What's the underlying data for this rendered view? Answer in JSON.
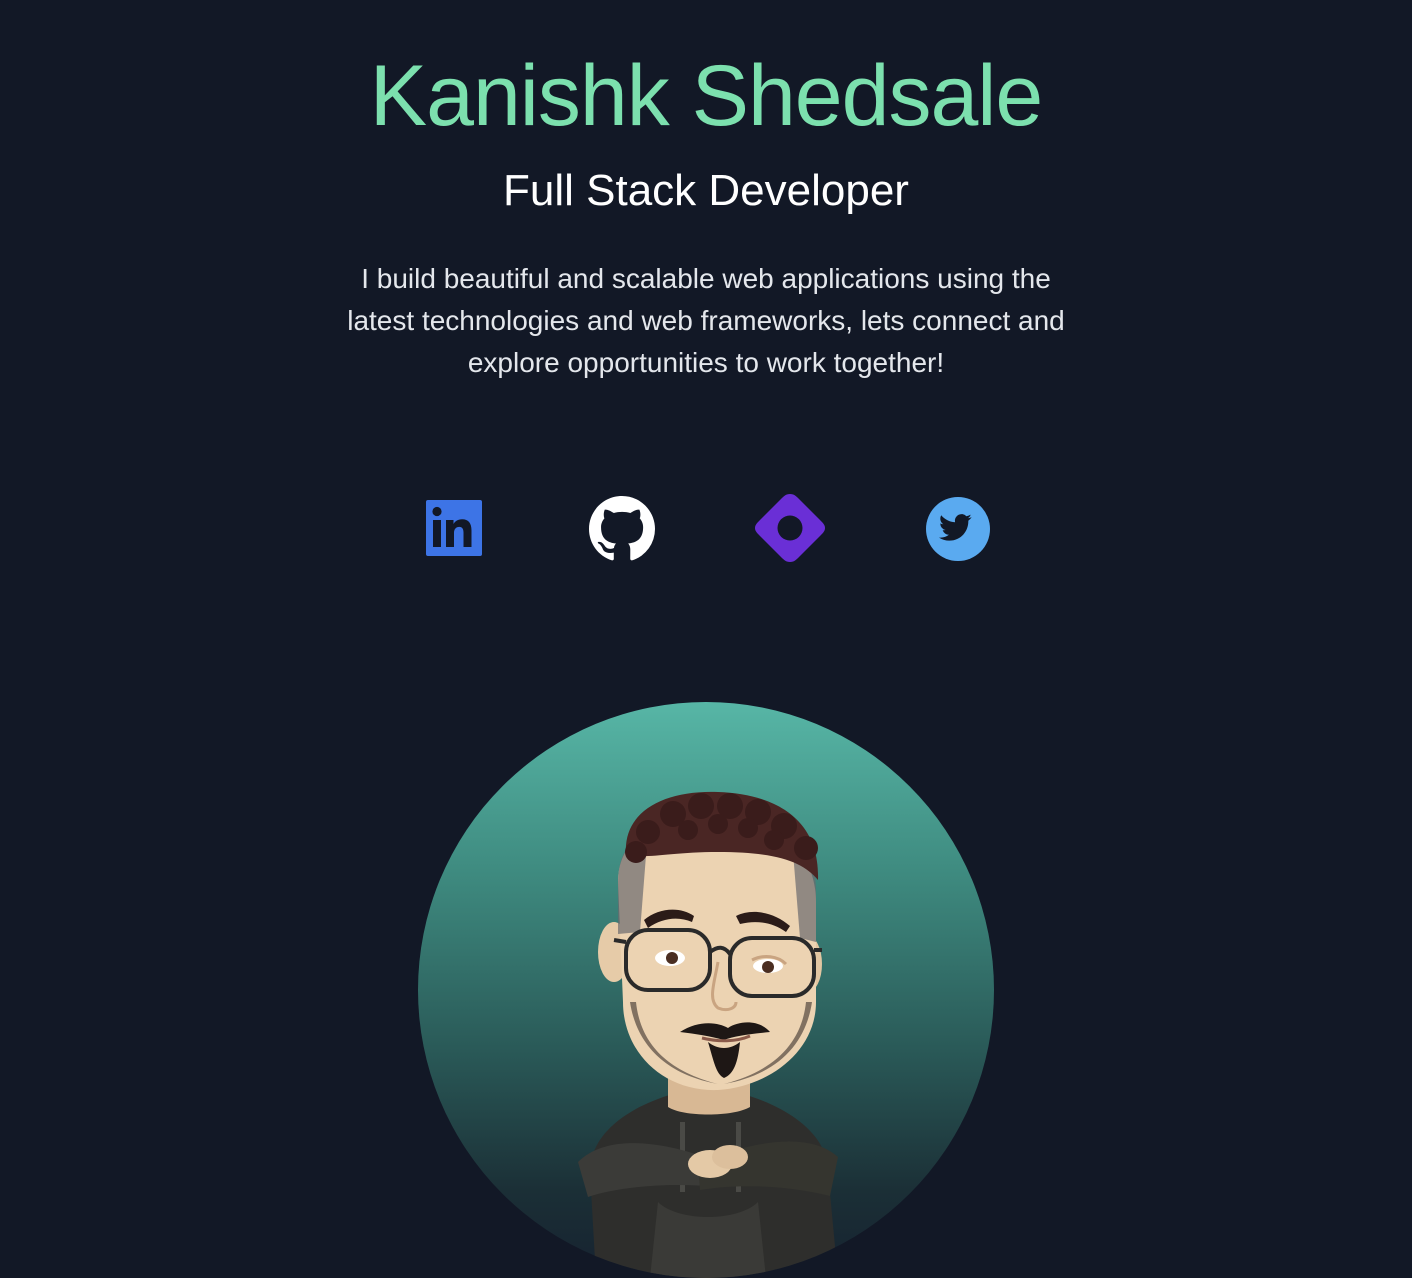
{
  "profile": {
    "name": "Kanishk Shedsale",
    "role": "Full Stack Developer",
    "bio_lines": [
      "I build beautiful and scalable web applications using the",
      "latest technologies and web frameworks, lets connect and",
      "explore opportunities to work together!"
    ]
  },
  "socials": [
    {
      "id": "linkedin",
      "icon": "linkedin-icon",
      "color": "#3d74e6"
    },
    {
      "id": "github",
      "icon": "github-icon",
      "color": "#ffffff"
    },
    {
      "id": "website",
      "icon": "diamond-ring-icon",
      "color": "#6a2fd6"
    },
    {
      "id": "twitter",
      "icon": "twitter-icon",
      "color": "#5aaaf0"
    }
  ],
  "avatar": {
    "icon": "memoji-avatar",
    "gradient_top": "#57b6a6",
    "gradient_bottom": "#162230"
  },
  "colors": {
    "background": "#121826",
    "name": "#7ce0ae",
    "role": "#ffffff",
    "bio": "#e4e7ec"
  }
}
